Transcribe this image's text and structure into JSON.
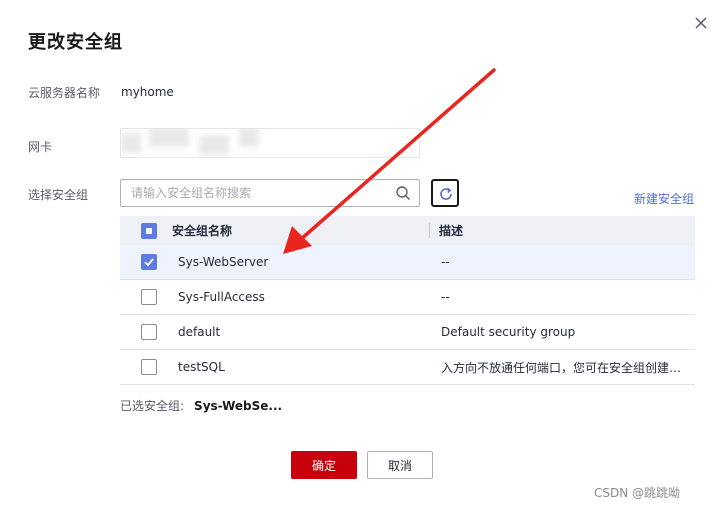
{
  "dialog": {
    "title": "更改安全组",
    "close_icon": "close-icon"
  },
  "form": {
    "server_name_label": "云服务器名称",
    "server_name_value": "myhome",
    "nic_label": "网卡",
    "select_sg_label": "选择安全组",
    "search_placeholder": "请输入安全组名称搜索",
    "search_icon": "search-icon",
    "refresh_icon": "refresh-icon",
    "new_sg_link": "新建安全组"
  },
  "table": {
    "headers": {
      "name": "安全组名称",
      "description": "描述"
    },
    "header_checkbox": "partial",
    "rows": [
      {
        "name": "Sys-WebServer",
        "description": "--",
        "checked": true
      },
      {
        "name": "Sys-FullAccess",
        "description": "--",
        "checked": false
      },
      {
        "name": "default",
        "description": "Default security group",
        "checked": false
      },
      {
        "name": "testSQL",
        "description": "入方向不放通任何端口，您可在安全组创建…",
        "checked": false
      }
    ]
  },
  "selected": {
    "label": "已选安全组:",
    "value": "Sys-WebSe..."
  },
  "buttons": {
    "ok": "确定",
    "cancel": "取消"
  },
  "watermark": "CSDN @跳跳呦",
  "colors": {
    "primary_red": "#c7000b",
    "link_blue": "#526ecc",
    "checkbox_blue": "#5e7ce0",
    "arrow_red": "#e8261f"
  }
}
